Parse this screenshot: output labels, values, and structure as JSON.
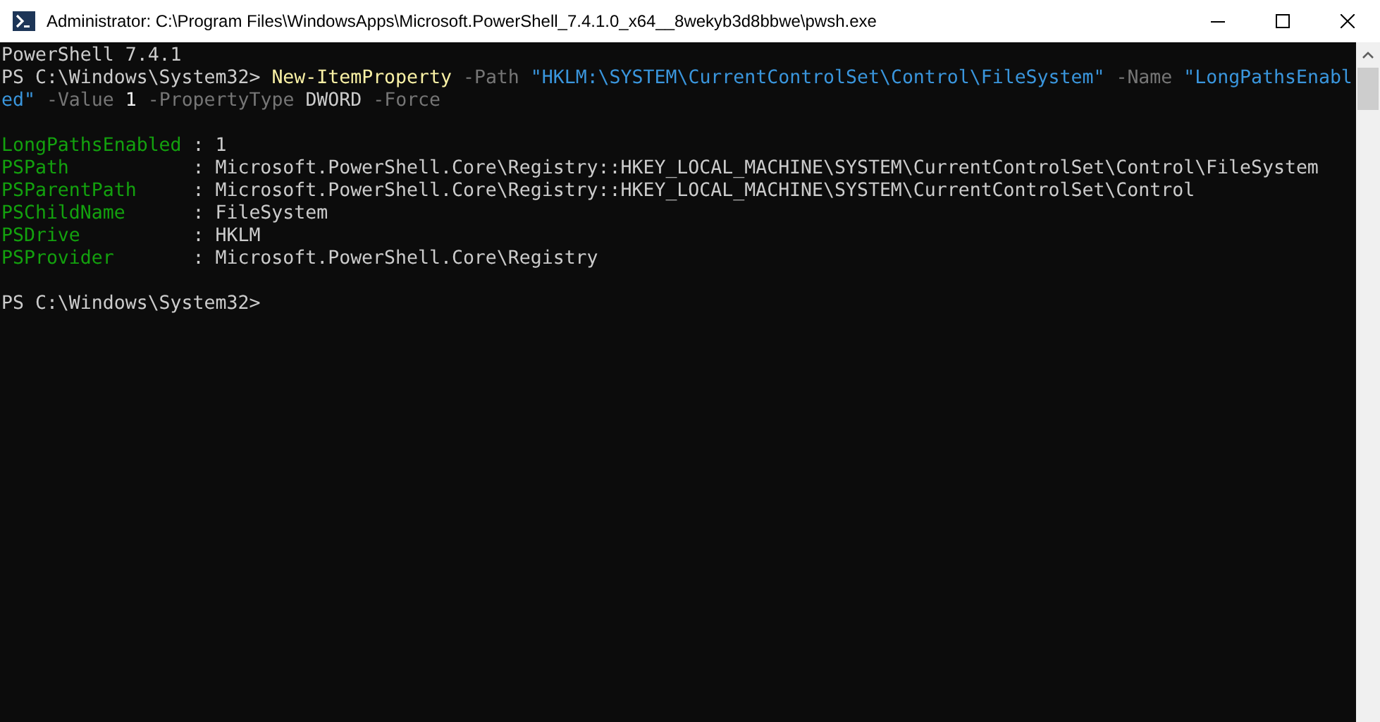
{
  "window": {
    "title": "Administrator: C:\\Program Files\\WindowsApps\\Microsoft.PowerShell_7.4.1.0_x64__8wekyb3d8bbwe\\pwsh.exe"
  },
  "console": {
    "lines": [
      {
        "kind": "text",
        "text": "PowerShell 7.4.1"
      },
      {
        "kind": "command",
        "segments": [
          {
            "kind": "prompt",
            "text": "PS C:\\Windows\\System32> "
          },
          {
            "kind": "command",
            "text": "New-ItemProperty"
          },
          {
            "kind": "parameter",
            "text": " -Path "
          },
          {
            "kind": "string",
            "text": "\"HKLM:\\SYSTEM\\CurrentControlSet\\Control\\FileSystem\""
          },
          {
            "kind": "parameter",
            "text": " -Name "
          },
          {
            "kind": "string",
            "text": "\"LongPathsEnabled\""
          },
          {
            "kind": "parameter",
            "text": " -Value "
          },
          {
            "kind": "number",
            "text": "1"
          },
          {
            "kind": "parameter",
            "text": " -PropertyType "
          },
          {
            "kind": "plain",
            "text": "DWORD"
          },
          {
            "kind": "parameter",
            "text": " -Force"
          }
        ]
      },
      {
        "kind": "blank"
      },
      {
        "kind": "property",
        "name": "LongPathsEnabled",
        "sep": ":",
        "value": "1"
      },
      {
        "kind": "property",
        "name": "PSPath",
        "sep": ":",
        "value": "Microsoft.PowerShell.Core\\Registry::HKEY_LOCAL_MACHINE\\SYSTEM\\CurrentControlSet\\Control\\FileSystem"
      },
      {
        "kind": "property",
        "name": "PSParentPath",
        "sep": ":",
        "value": "Microsoft.PowerShell.Core\\Registry::HKEY_LOCAL_MACHINE\\SYSTEM\\CurrentControlSet\\Control"
      },
      {
        "kind": "property",
        "name": "PSChildName",
        "sep": ":",
        "value": "FileSystem"
      },
      {
        "kind": "property",
        "name": "PSDrive",
        "sep": ":",
        "value": "HKLM"
      },
      {
        "kind": "property",
        "name": "PSProvider",
        "sep": ":",
        "value": "Microsoft.PowerShell.Core\\Registry"
      },
      {
        "kind": "blank"
      },
      {
        "kind": "text",
        "text": "PS C:\\Windows\\System32>"
      }
    ]
  }
}
